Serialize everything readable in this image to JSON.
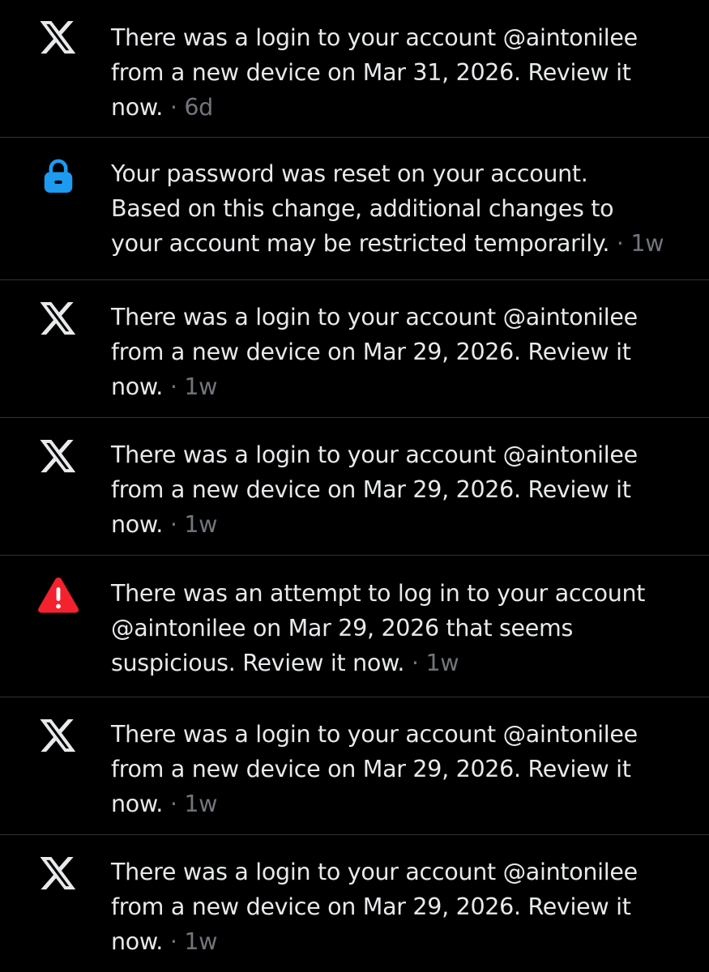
{
  "colors": {
    "background": "#000000",
    "text": "#e7e9ea",
    "muted": "#71767b",
    "divider": "#2f3336",
    "lock": "#1d9bf0",
    "alert": "#f4212e"
  },
  "notifications": [
    {
      "icon": "x-logo-icon",
      "lines": [
        "There was a login to your account @aintonilee",
        "from a new device on Mar 31, 2026. Review it",
        "now."
      ],
      "time": "6d"
    },
    {
      "icon": "lock-icon",
      "lines": [
        "Your password was reset on your account.",
        "Based on this change, additional changes to",
        "your account may be restricted temporarily."
      ],
      "time": "1w"
    },
    {
      "icon": "x-logo-icon",
      "lines": [
        "There was a login to your account @aintonilee",
        "from a new device on Mar 29, 2026. Review it",
        "now."
      ],
      "time": "1w"
    },
    {
      "icon": "x-logo-icon",
      "lines": [
        "There was a login to your account @aintonilee",
        "from a new device on Mar 29, 2026. Review it",
        "now."
      ],
      "time": "1w"
    },
    {
      "icon": "warning-icon",
      "lines": [
        "There was an attempt to log in to your account",
        "@aintonilee on Mar 29, 2026 that seems",
        "suspicious. Review it now."
      ],
      "time": "1w"
    },
    {
      "icon": "x-logo-icon",
      "lines": [
        "There was a login to your account @aintonilee",
        "from a new device on Mar 29, 2026. Review it",
        "now."
      ],
      "time": "1w"
    },
    {
      "icon": "x-logo-icon",
      "lines": [
        "There was a login to your account @aintonilee",
        "from a new device on Mar 29, 2026. Review it",
        "now."
      ],
      "time": "1w"
    }
  ]
}
